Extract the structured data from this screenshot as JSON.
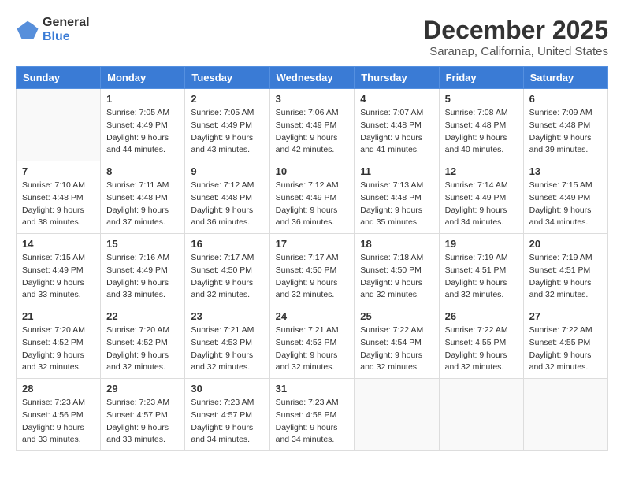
{
  "logo": {
    "general": "General",
    "blue": "Blue"
  },
  "title": "December 2025",
  "subtitle": "Saranap, California, United States",
  "days_header": [
    "Sunday",
    "Monday",
    "Tuesday",
    "Wednesday",
    "Thursday",
    "Friday",
    "Saturday"
  ],
  "weeks": [
    [
      {
        "day": "",
        "sunrise": "",
        "sunset": "",
        "daylight": "",
        "empty": true
      },
      {
        "day": "1",
        "sunrise": "Sunrise: 7:05 AM",
        "sunset": "Sunset: 4:49 PM",
        "daylight": "Daylight: 9 hours and 44 minutes."
      },
      {
        "day": "2",
        "sunrise": "Sunrise: 7:05 AM",
        "sunset": "Sunset: 4:49 PM",
        "daylight": "Daylight: 9 hours and 43 minutes."
      },
      {
        "day": "3",
        "sunrise": "Sunrise: 7:06 AM",
        "sunset": "Sunset: 4:49 PM",
        "daylight": "Daylight: 9 hours and 42 minutes."
      },
      {
        "day": "4",
        "sunrise": "Sunrise: 7:07 AM",
        "sunset": "Sunset: 4:48 PM",
        "daylight": "Daylight: 9 hours and 41 minutes."
      },
      {
        "day": "5",
        "sunrise": "Sunrise: 7:08 AM",
        "sunset": "Sunset: 4:48 PM",
        "daylight": "Daylight: 9 hours and 40 minutes."
      },
      {
        "day": "6",
        "sunrise": "Sunrise: 7:09 AM",
        "sunset": "Sunset: 4:48 PM",
        "daylight": "Daylight: 9 hours and 39 minutes."
      }
    ],
    [
      {
        "day": "7",
        "sunrise": "Sunrise: 7:10 AM",
        "sunset": "Sunset: 4:48 PM",
        "daylight": "Daylight: 9 hours and 38 minutes."
      },
      {
        "day": "8",
        "sunrise": "Sunrise: 7:11 AM",
        "sunset": "Sunset: 4:48 PM",
        "daylight": "Daylight: 9 hours and 37 minutes."
      },
      {
        "day": "9",
        "sunrise": "Sunrise: 7:12 AM",
        "sunset": "Sunset: 4:48 PM",
        "daylight": "Daylight: 9 hours and 36 minutes."
      },
      {
        "day": "10",
        "sunrise": "Sunrise: 7:12 AM",
        "sunset": "Sunset: 4:49 PM",
        "daylight": "Daylight: 9 hours and 36 minutes."
      },
      {
        "day": "11",
        "sunrise": "Sunrise: 7:13 AM",
        "sunset": "Sunset: 4:48 PM",
        "daylight": "Daylight: 9 hours and 35 minutes."
      },
      {
        "day": "12",
        "sunrise": "Sunrise: 7:14 AM",
        "sunset": "Sunset: 4:49 PM",
        "daylight": "Daylight: 9 hours and 34 minutes."
      },
      {
        "day": "13",
        "sunrise": "Sunrise: 7:15 AM",
        "sunset": "Sunset: 4:49 PM",
        "daylight": "Daylight: 9 hours and 34 minutes."
      }
    ],
    [
      {
        "day": "14",
        "sunrise": "Sunrise: 7:15 AM",
        "sunset": "Sunset: 4:49 PM",
        "daylight": "Daylight: 9 hours and 33 minutes."
      },
      {
        "day": "15",
        "sunrise": "Sunrise: 7:16 AM",
        "sunset": "Sunset: 4:49 PM",
        "daylight": "Daylight: 9 hours and 33 minutes."
      },
      {
        "day": "16",
        "sunrise": "Sunrise: 7:17 AM",
        "sunset": "Sunset: 4:50 PM",
        "daylight": "Daylight: 9 hours and 32 minutes."
      },
      {
        "day": "17",
        "sunrise": "Sunrise: 7:17 AM",
        "sunset": "Sunset: 4:50 PM",
        "daylight": "Daylight: 9 hours and 32 minutes."
      },
      {
        "day": "18",
        "sunrise": "Sunrise: 7:18 AM",
        "sunset": "Sunset: 4:50 PM",
        "daylight": "Daylight: 9 hours and 32 minutes."
      },
      {
        "day": "19",
        "sunrise": "Sunrise: 7:19 AM",
        "sunset": "Sunset: 4:51 PM",
        "daylight": "Daylight: 9 hours and 32 minutes."
      },
      {
        "day": "20",
        "sunrise": "Sunrise: 7:19 AM",
        "sunset": "Sunset: 4:51 PM",
        "daylight": "Daylight: 9 hours and 32 minutes."
      }
    ],
    [
      {
        "day": "21",
        "sunrise": "Sunrise: 7:20 AM",
        "sunset": "Sunset: 4:52 PM",
        "daylight": "Daylight: 9 hours and 32 minutes."
      },
      {
        "day": "22",
        "sunrise": "Sunrise: 7:20 AM",
        "sunset": "Sunset: 4:52 PM",
        "daylight": "Daylight: 9 hours and 32 minutes."
      },
      {
        "day": "23",
        "sunrise": "Sunrise: 7:21 AM",
        "sunset": "Sunset: 4:53 PM",
        "daylight": "Daylight: 9 hours and 32 minutes."
      },
      {
        "day": "24",
        "sunrise": "Sunrise: 7:21 AM",
        "sunset": "Sunset: 4:53 PM",
        "daylight": "Daylight: 9 hours and 32 minutes."
      },
      {
        "day": "25",
        "sunrise": "Sunrise: 7:22 AM",
        "sunset": "Sunset: 4:54 PM",
        "daylight": "Daylight: 9 hours and 32 minutes."
      },
      {
        "day": "26",
        "sunrise": "Sunrise: 7:22 AM",
        "sunset": "Sunset: 4:55 PM",
        "daylight": "Daylight: 9 hours and 32 minutes."
      },
      {
        "day": "27",
        "sunrise": "Sunrise: 7:22 AM",
        "sunset": "Sunset: 4:55 PM",
        "daylight": "Daylight: 9 hours and 32 minutes."
      }
    ],
    [
      {
        "day": "28",
        "sunrise": "Sunrise: 7:23 AM",
        "sunset": "Sunset: 4:56 PM",
        "daylight": "Daylight: 9 hours and 33 minutes."
      },
      {
        "day": "29",
        "sunrise": "Sunrise: 7:23 AM",
        "sunset": "Sunset: 4:57 PM",
        "daylight": "Daylight: 9 hours and 33 minutes."
      },
      {
        "day": "30",
        "sunrise": "Sunrise: 7:23 AM",
        "sunset": "Sunset: 4:57 PM",
        "daylight": "Daylight: 9 hours and 34 minutes."
      },
      {
        "day": "31",
        "sunrise": "Sunrise: 7:23 AM",
        "sunset": "Sunset: 4:58 PM",
        "daylight": "Daylight: 9 hours and 34 minutes."
      },
      {
        "day": "",
        "sunrise": "",
        "sunset": "",
        "daylight": "",
        "empty": true
      },
      {
        "day": "",
        "sunrise": "",
        "sunset": "",
        "daylight": "",
        "empty": true
      },
      {
        "day": "",
        "sunrise": "",
        "sunset": "",
        "daylight": "",
        "empty": true
      }
    ]
  ]
}
